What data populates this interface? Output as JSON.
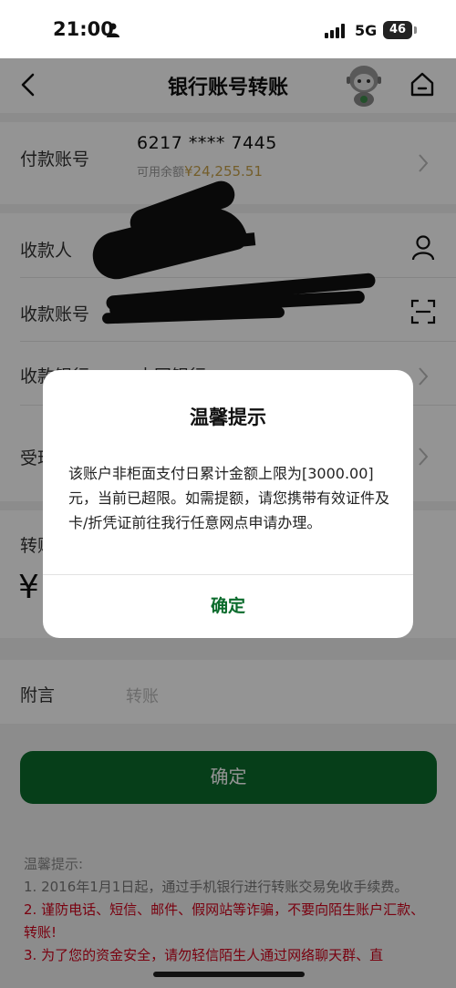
{
  "status_bar": {
    "time": "21:00",
    "network": "5G",
    "battery": "46"
  },
  "nav": {
    "title": "银行账号转账",
    "back_icon": "chevron-left-icon",
    "home_icon": "home-icon",
    "mascot_icon": "mascot-robot-icon"
  },
  "form": {
    "payer_label": "付款账号",
    "payer_account": "6217 **** 7445",
    "balance_label": "可用余额",
    "balance_value": "¥24,255.51",
    "payee_label": "收款人",
    "payee_account_label": "收款账号",
    "payee_bank_label": "收款银行",
    "payee_bank_value": "中国银行",
    "branch_label": "受理",
    "amount_label": "转账",
    "currency_symbol": "¥",
    "remark_label": "附言",
    "remark_placeholder": "转账"
  },
  "confirm_button": "确定",
  "tips": {
    "title": "温馨提示:",
    "line1": "1.  2016年1月1日起，通过手机银行进行转账交易免收手续费。",
    "line2": "2.  谨防电话、短信、邮件、假网站等诈骗，不要向陌生账户汇款、转账!",
    "line3": "3.  为了您的资金安全，请勿轻信陌生人通过网络聊天群、直"
  },
  "dialog": {
    "title": "温馨提示",
    "message": "该账户非柜面支付日累计金额上限为[3000.00]元，当前已超限。如需提额，请您携带有效证件及卡/折凭证前往我行任意网点申请办理。",
    "ok_label": "确定"
  },
  "colors": {
    "brand_green": "#0b6b2c",
    "warning_red": "#d0021b",
    "balance_gold": "#c8a24a"
  }
}
